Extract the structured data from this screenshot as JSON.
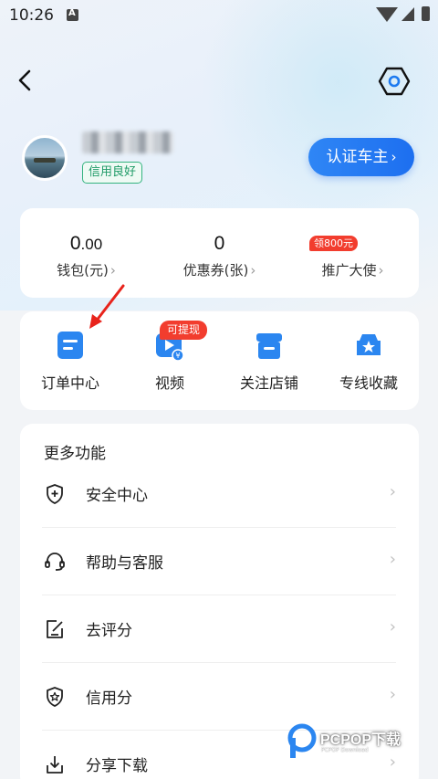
{
  "status_bar": {
    "time": "10:26",
    "notification_icon": "a-notification-icon",
    "wifi_icon": "wifi-icon",
    "signal_icon": "signal-icon",
    "battery_icon": "battery-icon"
  },
  "header": {
    "back_icon": "chevron-left-icon",
    "settings_icon": "hexagon-settings-icon"
  },
  "profile": {
    "username": "",
    "credit_badge": "信用良好",
    "verify_button": "认证车主",
    "verify_chevron": "›"
  },
  "stats": [
    {
      "value_main": "0",
      "value_decimal": ".00",
      "label": "钱包(元)"
    },
    {
      "value_main": "0",
      "value_decimal": "",
      "label": "优惠券(张)"
    },
    {
      "value_main": "",
      "value_decimal": "",
      "label": "推广大使"
    }
  ],
  "stats_chevron": "›",
  "promo_tag": "领800元",
  "shortcuts": [
    {
      "label": "订单中心",
      "icon": "order-doc-icon"
    },
    {
      "label": "视频",
      "icon": "video-icon"
    },
    {
      "label": "关注店铺",
      "icon": "store-icon"
    },
    {
      "label": "专线收藏",
      "icon": "car-star-icon"
    }
  ],
  "withdraw_tag": "可提现",
  "more": {
    "title": "更多功能",
    "items": [
      {
        "label": "安全中心",
        "icon": "shield-plus-icon"
      },
      {
        "label": "帮助与客服",
        "icon": "headset-icon"
      },
      {
        "label": "去评分",
        "icon": "edit-rating-icon"
      },
      {
        "label": "信用分",
        "icon": "shield-star-icon"
      },
      {
        "label": "分享下载",
        "icon": "download-icon"
      }
    ],
    "chevron": "›"
  },
  "watermark": {
    "title": "PCPOP下载",
    "subtitle": "PCPOP Download"
  },
  "colors": {
    "accent": "#1d6ff0",
    "badge_green": "#33b37f",
    "tag_red": "#f23d2e"
  }
}
